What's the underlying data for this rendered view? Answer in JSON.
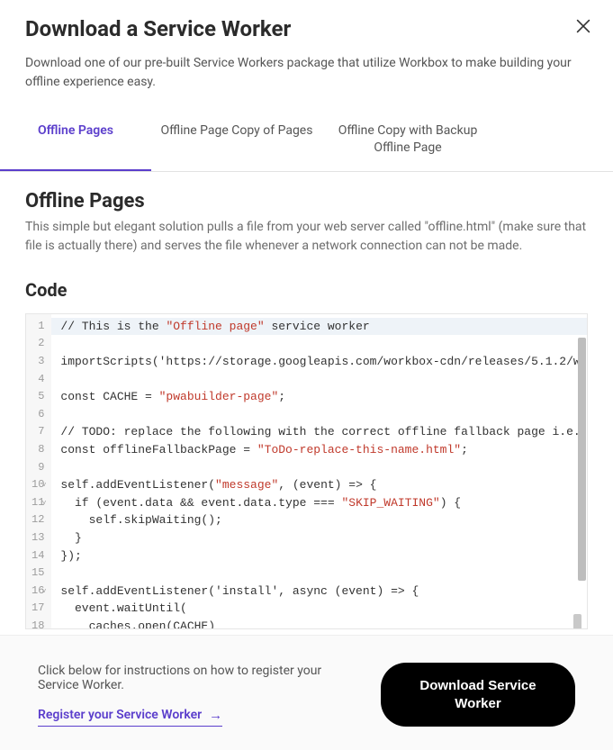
{
  "header": {
    "title": "Download a Service Worker",
    "subtitle": "Download one of our pre-built Service Workers package that utilize Workbox to make building your offline experience easy."
  },
  "tabs": [
    {
      "label": "Offline Pages",
      "active": true
    },
    {
      "label": "Offline Page Copy of Pages",
      "active": false
    },
    {
      "label": "Offline Copy with Backup Offline Page",
      "active": false
    }
  ],
  "section": {
    "title": "Offline Pages",
    "desc": "This simple but elegant solution pulls a file from your web server called \"offline.html\" (make sure that file is actually there) and serves the file whenever a network connection can not be made.",
    "code_label": "Code"
  },
  "code": {
    "line_numbers": [
      "1",
      "2",
      "3",
      "4",
      "5",
      "6",
      "7",
      "8",
      "9",
      "10",
      "11",
      "12",
      "13",
      "14",
      "15",
      "16",
      "17",
      "18"
    ],
    "fold_lines": [
      10,
      11,
      16
    ],
    "lines": [
      {
        "n": 1,
        "hl": true,
        "seg": [
          {
            "t": "// This is the "
          },
          {
            "t": "\"Offline page\"",
            "cls": "tok-str"
          },
          {
            "t": " service worker"
          }
        ]
      },
      {
        "n": 2,
        "seg": [
          {
            "t": ""
          }
        ]
      },
      {
        "n": 3,
        "seg": [
          {
            "t": "importScripts('https://storage.googleapis.com/workbox-cdn/releases/5.1.2/w"
          }
        ]
      },
      {
        "n": 4,
        "seg": [
          {
            "t": ""
          }
        ]
      },
      {
        "n": 5,
        "seg": [
          {
            "t": "const CACHE = "
          },
          {
            "t": "\"pwabuilder-page\"",
            "cls": "tok-str"
          },
          {
            "t": ";"
          }
        ]
      },
      {
        "n": 6,
        "seg": [
          {
            "t": ""
          }
        ]
      },
      {
        "n": 7,
        "seg": [
          {
            "t": "// TODO: replace the following with the correct offline fallback page i.e."
          }
        ]
      },
      {
        "n": 8,
        "seg": [
          {
            "t": "const offlineFallbackPage = "
          },
          {
            "t": "\"ToDo-replace-this-name.html\"",
            "cls": "tok-str"
          },
          {
            "t": ";"
          }
        ]
      },
      {
        "n": 9,
        "seg": [
          {
            "t": ""
          }
        ]
      },
      {
        "n": 10,
        "seg": [
          {
            "t": "self.addEventListener("
          },
          {
            "t": "\"message\"",
            "cls": "tok-str"
          },
          {
            "t": ", (event) => {"
          }
        ]
      },
      {
        "n": 11,
        "seg": [
          {
            "t": "  if (event.data && event.data.type === "
          },
          {
            "t": "\"SKIP_WAITING\"",
            "cls": "tok-str"
          },
          {
            "t": ") {"
          }
        ]
      },
      {
        "n": 12,
        "seg": [
          {
            "t": "    self.skipWaiting();"
          }
        ]
      },
      {
        "n": 13,
        "seg": [
          {
            "t": "  }"
          }
        ]
      },
      {
        "n": 14,
        "seg": [
          {
            "t": "});"
          }
        ]
      },
      {
        "n": 15,
        "seg": [
          {
            "t": ""
          }
        ]
      },
      {
        "n": 16,
        "seg": [
          {
            "t": "self.addEventListener('install', async (event) => {"
          }
        ]
      },
      {
        "n": 17,
        "seg": [
          {
            "t": "  event.waitUntil("
          }
        ]
      },
      {
        "n": 18,
        "seg": [
          {
            "t": "    caches.open(CACHE)"
          }
        ]
      }
    ]
  },
  "footer": {
    "hint": "Click below for instructions on how to register your Service Worker.",
    "link_text": "Register your Service Worker",
    "button_text": "Download Service Worker"
  }
}
